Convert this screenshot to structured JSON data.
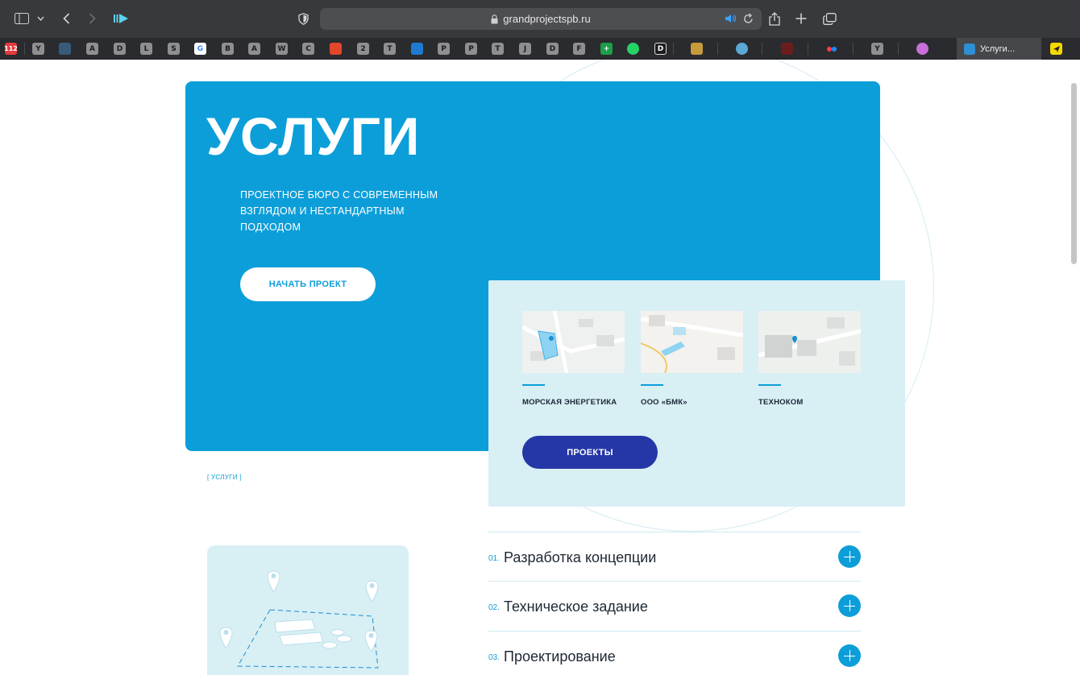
{
  "browser": {
    "url": "grandprojectspb.ru",
    "active_tab": "Услуги...",
    "bookmarks": [
      "Y",
      "A",
      "D",
      "L",
      "S",
      "B",
      "A",
      "W",
      "C",
      "2",
      "T",
      "P",
      "P",
      "T",
      "J",
      "D",
      "F",
      "D",
      "Y"
    ]
  },
  "hero": {
    "title": "УСЛУГИ",
    "subtitle": "ПРОЕКТНОЕ БЮРО С СОВРЕМЕННЫМ ВЗГЛЯДОМ И НЕСТАНДАРТНЫМ ПОДХОДОМ",
    "cta_label": "НАЧАТЬ ПРОЕКТ"
  },
  "breadcrumb": "[ УСЛУГИ ]",
  "projects": {
    "items": [
      {
        "name": "МОРСКАЯ ЭНЕРГЕТИКА"
      },
      {
        "name": "ООО «БМК»"
      },
      {
        "name": "ТЕХНОКОМ"
      }
    ],
    "button_label": "ПРОЕКТЫ"
  },
  "services": [
    {
      "num": "01.",
      "label": "Разработка концепции"
    },
    {
      "num": "02.",
      "label": "Техническое задание"
    },
    {
      "num": "03.",
      "label": "Проектирование"
    }
  ],
  "colors": {
    "brand_blue": "#0c9ed9",
    "dark_blue": "#2537a6",
    "light_bg": "#d8eff4",
    "text_dark": "#1d2733"
  }
}
